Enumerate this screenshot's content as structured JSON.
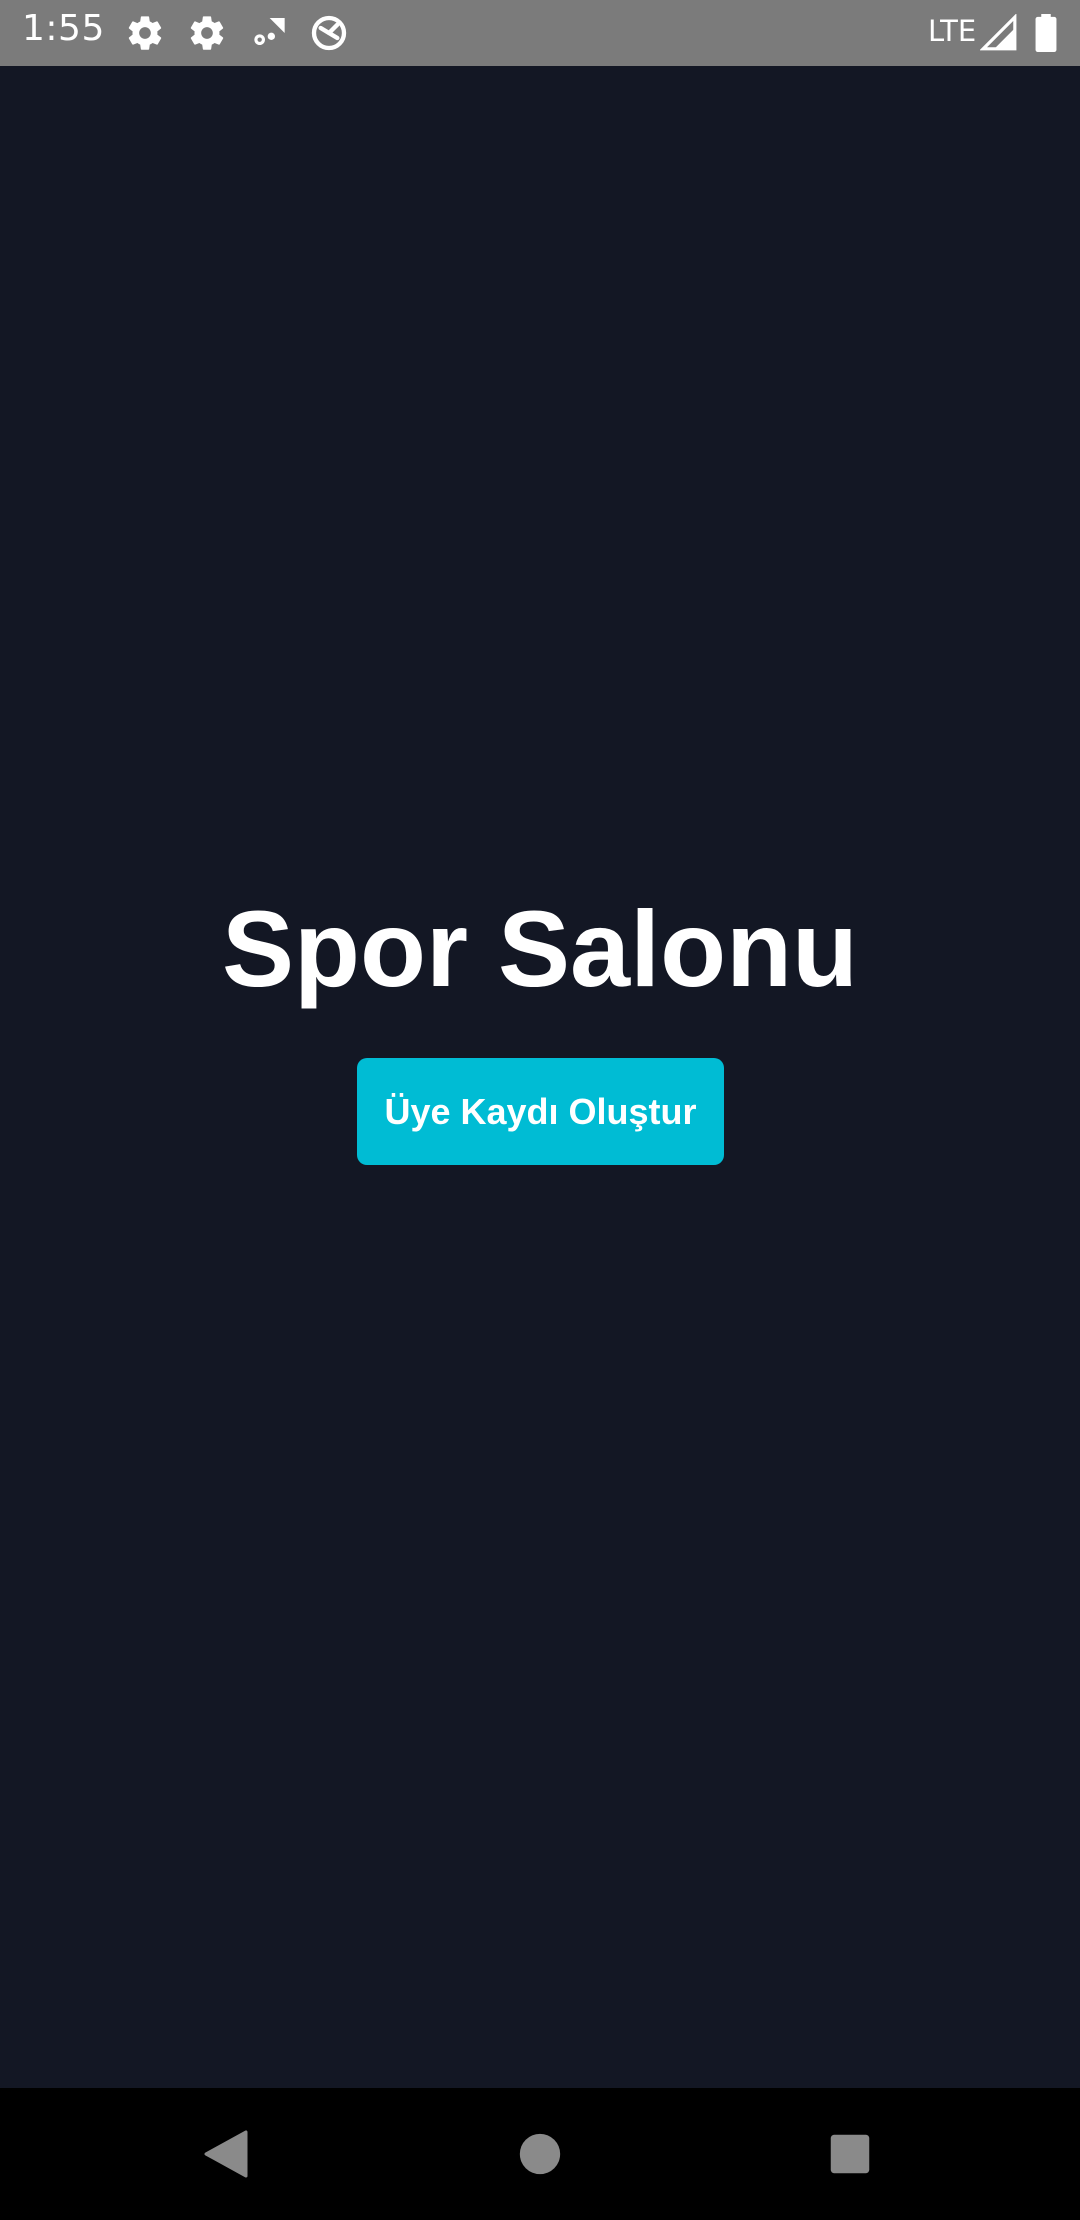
{
  "status_bar": {
    "time": "1:55",
    "network_label": "LTE",
    "icons": [
      "settings-icon",
      "settings-icon",
      "signal-data-icon",
      "vpn-icon",
      "cell-signal-icon",
      "battery-icon"
    ],
    "background_color": "#7b7b7b"
  },
  "main": {
    "title": "Spor Salonu",
    "register_button_label": "Üye Kaydı Oluştur",
    "background_color": "#131724",
    "accent_color": "#00bcd4"
  },
  "nav_bar": {
    "icons": [
      "back-icon",
      "home-icon",
      "recents-icon"
    ]
  }
}
